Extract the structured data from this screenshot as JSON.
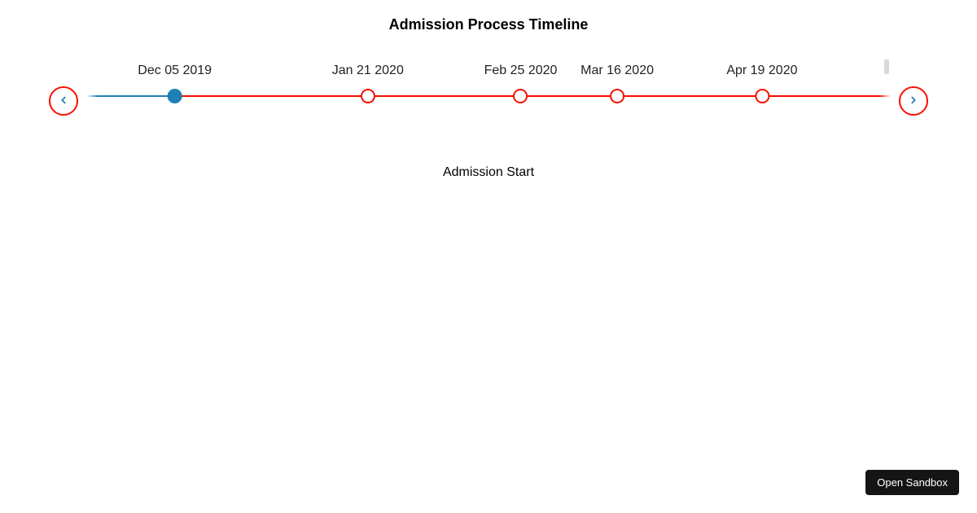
{
  "title": "Admission Process Timeline",
  "timeline": {
    "active_index": 0,
    "events": [
      {
        "label": "Dec 05 2019",
        "pos": 11
      },
      {
        "label": "Jan 21 2020",
        "pos": 35
      },
      {
        "label": "Feb 25 2020",
        "pos": 54
      },
      {
        "label": "Mar 16 2020",
        "pos": 66
      },
      {
        "label": "Apr 19 2020",
        "pos": 84
      }
    ]
  },
  "description": "Admission Start",
  "sandbox_button": "Open Sandbox",
  "colors": {
    "accent_red": "#f71002",
    "active_blue": "#1d7fb5"
  }
}
